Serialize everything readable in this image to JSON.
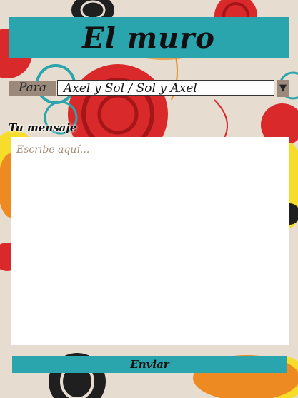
{
  "header": {
    "title": "El muro"
  },
  "recipient": {
    "label": "Para",
    "selected": "Axel y Sol / Sol y Axel",
    "arrow": "▼"
  },
  "message": {
    "label": "Tu mensaje",
    "placeholder": "Escribe aquí..."
  },
  "actions": {
    "send_label": "Enviar"
  },
  "colors": {
    "accent": "#2aa5ad",
    "label_bg": "#9b8a7c",
    "placeholder": "#a48e78",
    "background": "#e6ddd0"
  }
}
